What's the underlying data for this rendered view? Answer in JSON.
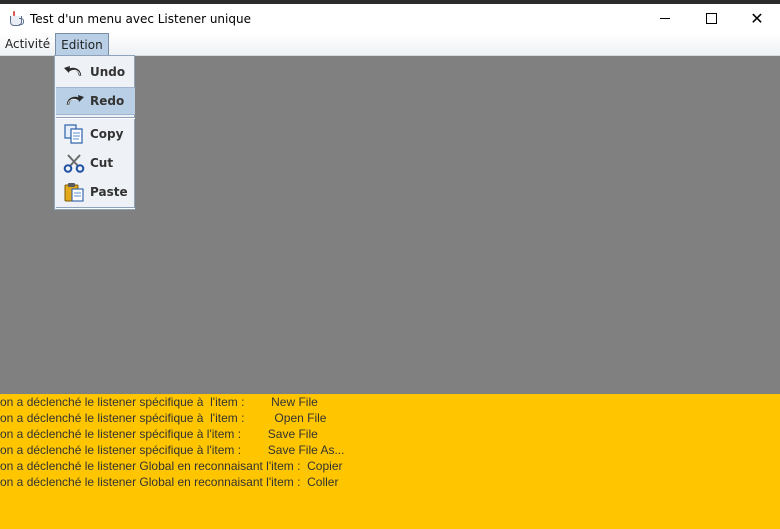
{
  "window": {
    "title": "Test d'un menu avec Listener unique",
    "minimize_label": "",
    "maximize_label": "",
    "close_glyph": "✕"
  },
  "menubar": {
    "items": [
      {
        "label": "Activité",
        "state": "closed"
      },
      {
        "label": "Edition",
        "state": "open"
      }
    ]
  },
  "popup": {
    "items": [
      {
        "label": "Undo",
        "icon": "undo-icon",
        "highlighted": false
      },
      {
        "label": "Redo",
        "icon": "redo-icon",
        "highlighted": true
      },
      {
        "label": "Copy",
        "icon": "copy-icon",
        "highlighted": false
      },
      {
        "label": "Cut",
        "icon": "cut-icon",
        "highlighted": false
      },
      {
        "label": "Paste",
        "icon": "paste-icon",
        "highlighted": false
      }
    ]
  },
  "log": {
    "lines": [
      "on a déclenché le listener spécifique à  l'item :        New File",
      "on a déclenché le listener spécifique à  l'item :         Open File",
      "on a déclenché le listener spécifique à l'item :        Save File",
      "on a déclenché le listener spécifique à l'item :        Save File As...",
      "on a déclenché le listener Global en reconnaisant l'item :  Copier",
      "on a déclenché le listener Global en reconnaisant l'item :  Coller"
    ]
  },
  "colors": {
    "content_bg": "#808080",
    "log_bg": "#ffc600",
    "highlight": "#b8cfe5"
  }
}
